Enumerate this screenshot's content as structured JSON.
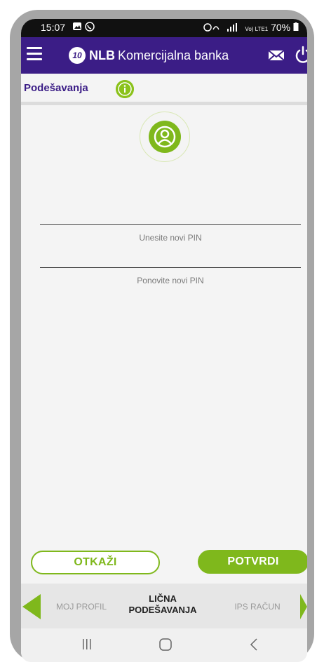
{
  "status_bar": {
    "time": "15:07",
    "battery": "70%",
    "network": "Vo) LTE1"
  },
  "header": {
    "brand_bold": "NLB",
    "brand_text": "Komercijalna banka",
    "logo_mark": "10"
  },
  "subheader": {
    "title": "Podešavanja"
  },
  "form": {
    "new_pin_label": "Unesite novi PIN",
    "repeat_pin_label": "Ponovite novi PIN"
  },
  "buttons": {
    "cancel": "OTKAŽI",
    "confirm": "POTVRDI"
  },
  "tabs": {
    "prev": "MOJ PROFIL",
    "current_line1": "LIČNA",
    "current_line2": "PODEŠAVANJA",
    "next": "IPS RAČUN"
  },
  "colors": {
    "brand_purple": "#3b1d86",
    "accent_green": "#7fb81c"
  },
  "icons": [
    "menu-icon",
    "mail-icon",
    "power-icon",
    "info-icon",
    "user-avatar-icon",
    "chevron-left-icon",
    "chevron-right-icon",
    "recent-apps-icon",
    "home-icon",
    "back-icon"
  ]
}
